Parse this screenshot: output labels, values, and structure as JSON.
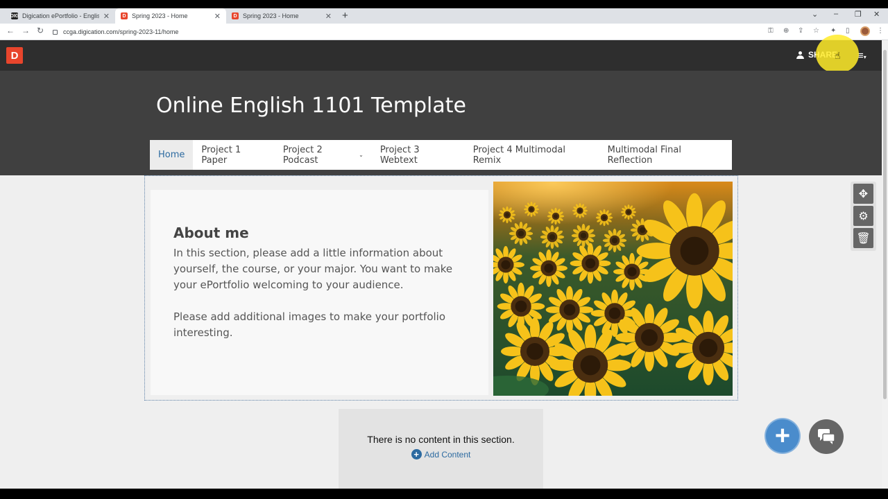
{
  "browser": {
    "tabs": [
      {
        "title": "Digication ePortfolio - English Co",
        "favicon": "DIG"
      },
      {
        "title": "Spring 2023 - Home",
        "favicon": "D",
        "active": true
      },
      {
        "title": "Spring 2023 - Home",
        "favicon": "D"
      }
    ],
    "url": "ccga.digication.com/spring-2023-11/home"
  },
  "app": {
    "logo": "D",
    "share_label": "SHARE",
    "accent": "#e8452c"
  },
  "site": {
    "title": "Online English 1101 Template",
    "nav": [
      {
        "label": "Home",
        "active": true
      },
      {
        "label": "Project 1 Paper"
      },
      {
        "label": "Project 2 Podcast",
        "has_dropdown": true
      },
      {
        "label": "Project 3 Webtext"
      },
      {
        "label": "Project 4 Multimodal Remix"
      },
      {
        "label": "Multimodal Final Reflection"
      }
    ]
  },
  "about": {
    "title": "About me",
    "paragraph1": "In this section, please add a little information about yourself, the course, or your major. You want to make your ePortfolio welcoming to your audience.",
    "paragraph2": "Please add additional images to make your portfolio interesting."
  },
  "empty_section": {
    "message": "There is no content in this section.",
    "add_label": "Add Content"
  },
  "icons": {
    "move": "move-icon",
    "settings": "gear-icon",
    "delete": "trash-icon",
    "add": "plus-icon",
    "chat": "chat-icon"
  }
}
